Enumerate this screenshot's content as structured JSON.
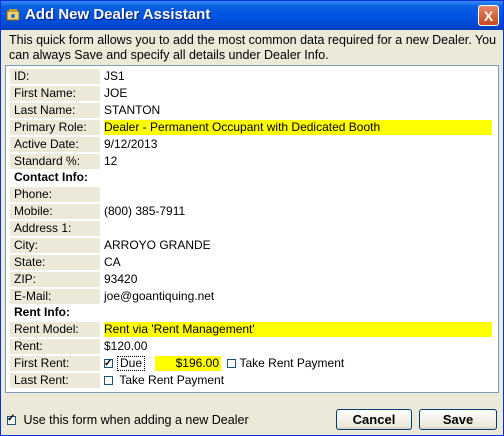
{
  "window": {
    "title": "Add New Dealer Assistant",
    "close_glyph": "X"
  },
  "intro": "This quick form allows you to add the most common data required for a new Dealer.  You can always Save and specify all details under Dealer Info.",
  "fields": [
    {
      "label": "ID:",
      "value": "JS1",
      "highlight": false
    },
    {
      "label": "First Name:",
      "value": "JOE",
      "highlight": false
    },
    {
      "label": "Last Name:",
      "value": "STANTON",
      "highlight": false
    },
    {
      "label": "Primary Role:",
      "value": "Dealer - Permanent Occupant with Dedicated Booth",
      "highlight": true
    },
    {
      "label": "Active Date:",
      "value": "9/12/2013",
      "highlight": false
    },
    {
      "label": "Standard %:",
      "value": "12",
      "highlight": false
    }
  ],
  "contact": {
    "heading": "Contact Info:",
    "fields": [
      {
        "label": "Phone:",
        "value": ""
      },
      {
        "label": "Mobile:",
        "value": "(800) 385-7911"
      },
      {
        "label": "Address 1:",
        "value": ""
      },
      {
        "label": "City:",
        "value": "ARROYO GRANDE"
      },
      {
        "label": "State:",
        "value": "CA"
      },
      {
        "label": "ZIP:",
        "value": "93420"
      },
      {
        "label": "E-Mail:",
        "value": "joe@goantiquing.net"
      }
    ]
  },
  "rent": {
    "heading": "Rent Info:",
    "model_label": "Rent Model:",
    "model_value": "Rent via 'Rent Management'",
    "rent_label": "Rent:",
    "rent_value": "$120.00",
    "first_label": "First Rent:",
    "first_due_label": "Due",
    "first_due_checked": true,
    "first_amount": "$196.00",
    "first_take_label": "Take Rent Payment",
    "first_take_checked": false,
    "last_label": "Last Rent:",
    "last_take_label": "Take Rent Payment",
    "last_take_checked": false
  },
  "footer": {
    "use_form_label": "Use this form when adding a new Dealer",
    "use_form_checked": true,
    "cancel_label": "Cancel",
    "save_label": "Save"
  }
}
